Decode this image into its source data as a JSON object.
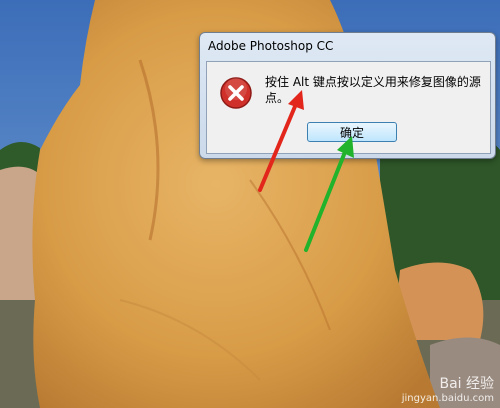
{
  "dialog": {
    "title": "Adobe Photoshop CC",
    "message": "按住 Alt 键点按以定义用来修复图像的源点。",
    "ok_label": "确定",
    "icon": "error-icon"
  },
  "watermark": {
    "brand": "Bai 经验",
    "url": "jingyan.baidu.com"
  },
  "colors": {
    "sky": "#3f6fb8",
    "rock": "#d9a24c",
    "error_red": "#d0302a",
    "arrow_red": "#e2261c",
    "arrow_green": "#21b32b"
  }
}
